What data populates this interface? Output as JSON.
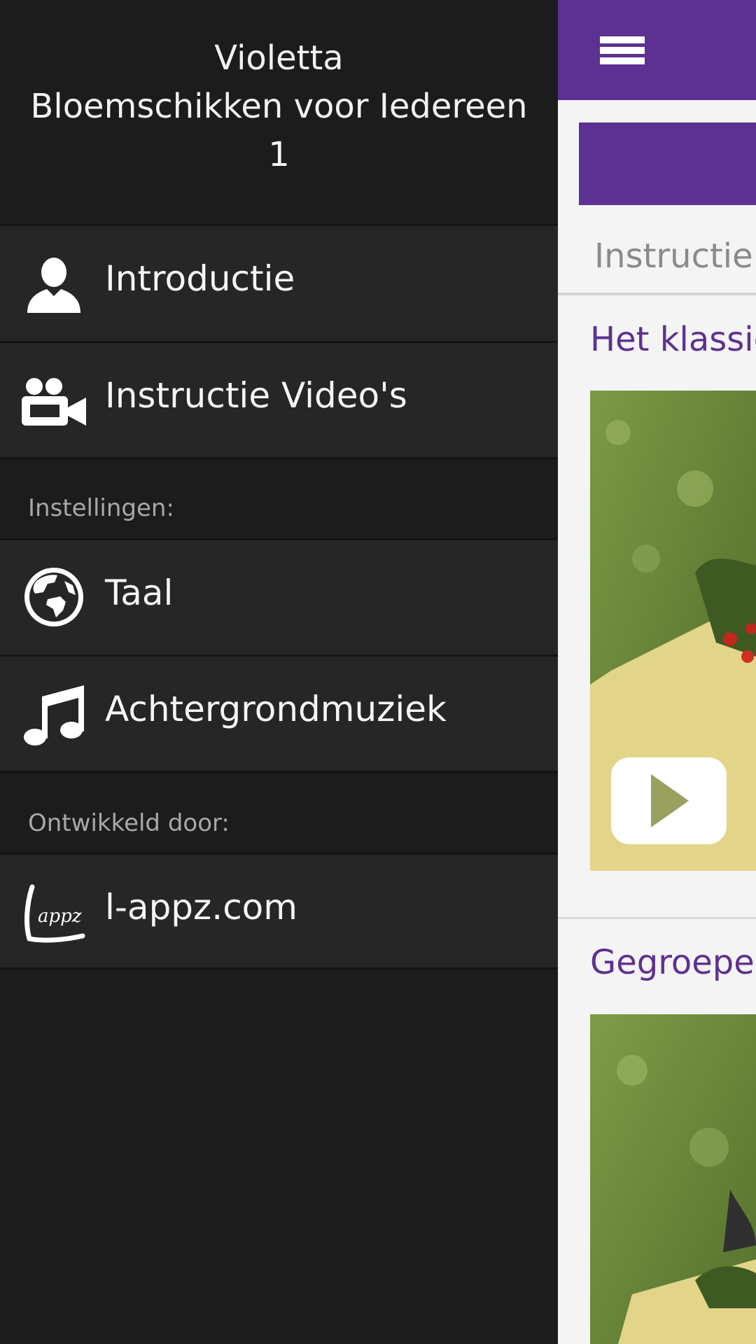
{
  "drawer": {
    "title": "Violetta\nBloemschikken voor Iedereen\n1",
    "items": [
      {
        "label": "Introductie",
        "icon": "person-icon"
      },
      {
        "label": "Instructie Video's",
        "icon": "video-camera-icon"
      }
    ],
    "settings_label": "Instellingen:",
    "settings_items": [
      {
        "label": "Taal",
        "icon": "globe-icon"
      },
      {
        "label": "Achtergrondmuziek",
        "icon": "music-note-icon"
      }
    ],
    "developed_label": "Ontwikkeld door:",
    "developer": {
      "label": "l-appz.com",
      "icon": "lappz-logo"
    }
  },
  "main": {
    "menu_icon": "hamburger-menu-icon",
    "tab": "Instructie",
    "cards": [
      {
        "title": "Het klassie"
      },
      {
        "title": "Gegroepee"
      }
    ],
    "play_icon": "play-icon"
  },
  "colors": {
    "accent": "#5d3191",
    "drawer_bg": "#1c1c1c",
    "item_bg": "#262626"
  }
}
